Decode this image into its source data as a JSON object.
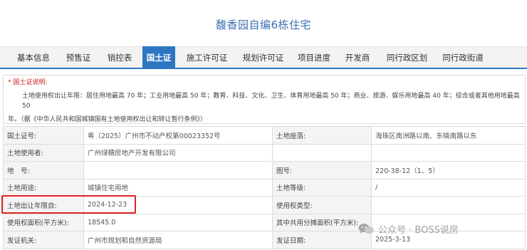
{
  "page_title": "馥香园自编6栋住宅",
  "tabs": [
    {
      "label": "基本信息",
      "active": false
    },
    {
      "label": "预售证",
      "active": false
    },
    {
      "label": "销控表",
      "active": false
    },
    {
      "label": "国土证",
      "active": true
    },
    {
      "label": "施工许可证",
      "active": false
    },
    {
      "label": "规划许可证",
      "active": false
    },
    {
      "label": "项目进度",
      "active": false
    },
    {
      "label": "开发商",
      "active": false
    },
    {
      "label": "同行政区划",
      "active": false
    },
    {
      "label": "同行政街道",
      "active": false
    }
  ],
  "note": {
    "heading": "* 国土证说明:",
    "line1": "土地使用权出让年限：居住用地最高 70 年；工业用地最高 50 年；教育、科技、文化、卫生、体育用地最高 50 年；商业、旅游、娱乐用地最高 40 年；综合或者其他用地最高 50",
    "line2": "年。（据《中华人民共和国城镇国有土地使用权出让和转让暂行条例》）"
  },
  "table": {
    "rows": [
      {
        "l1": "国土证号:",
        "v1": "粤（2025）广州市不动产权第00023352号",
        "l2": "土地座落:",
        "v2": "海珠区南洲路以南、东晓南路以东"
      },
      {
        "l1": "土地使用者:",
        "v1": "广州绿穗房地产开发有限公司",
        "l2": "",
        "v2": ""
      },
      {
        "l1": "地　号:",
        "v1": "",
        "l2": "图号:",
        "v2": "220-38-12（1、5）"
      },
      {
        "l1": "土地用途:",
        "v1": "城镇住宅用地",
        "l2": "土地等级:",
        "v2": "/"
      },
      {
        "l1": "土地出让年限自:",
        "v1": "2024-12-23",
        "l2": "使用权类型:",
        "v2": ""
      },
      {
        "l1": "使用权面积(平方米):",
        "v1": "18545.0",
        "l2": "其中共用分摊面积(平方米):",
        "v2": ""
      },
      {
        "l1": "发证机关:",
        "v1": "广州市规划和自然资源局",
        "l2": "发证日期:",
        "v2": "2025-3-13"
      }
    ]
  },
  "watermark": {
    "text": "公众号 · BOSS说房",
    "icon": "wechat-icon"
  },
  "colors": {
    "accent": "#2f76c2",
    "title": "#3a6fb0",
    "highlight": "#e02424",
    "note_head": "#d02020"
  }
}
